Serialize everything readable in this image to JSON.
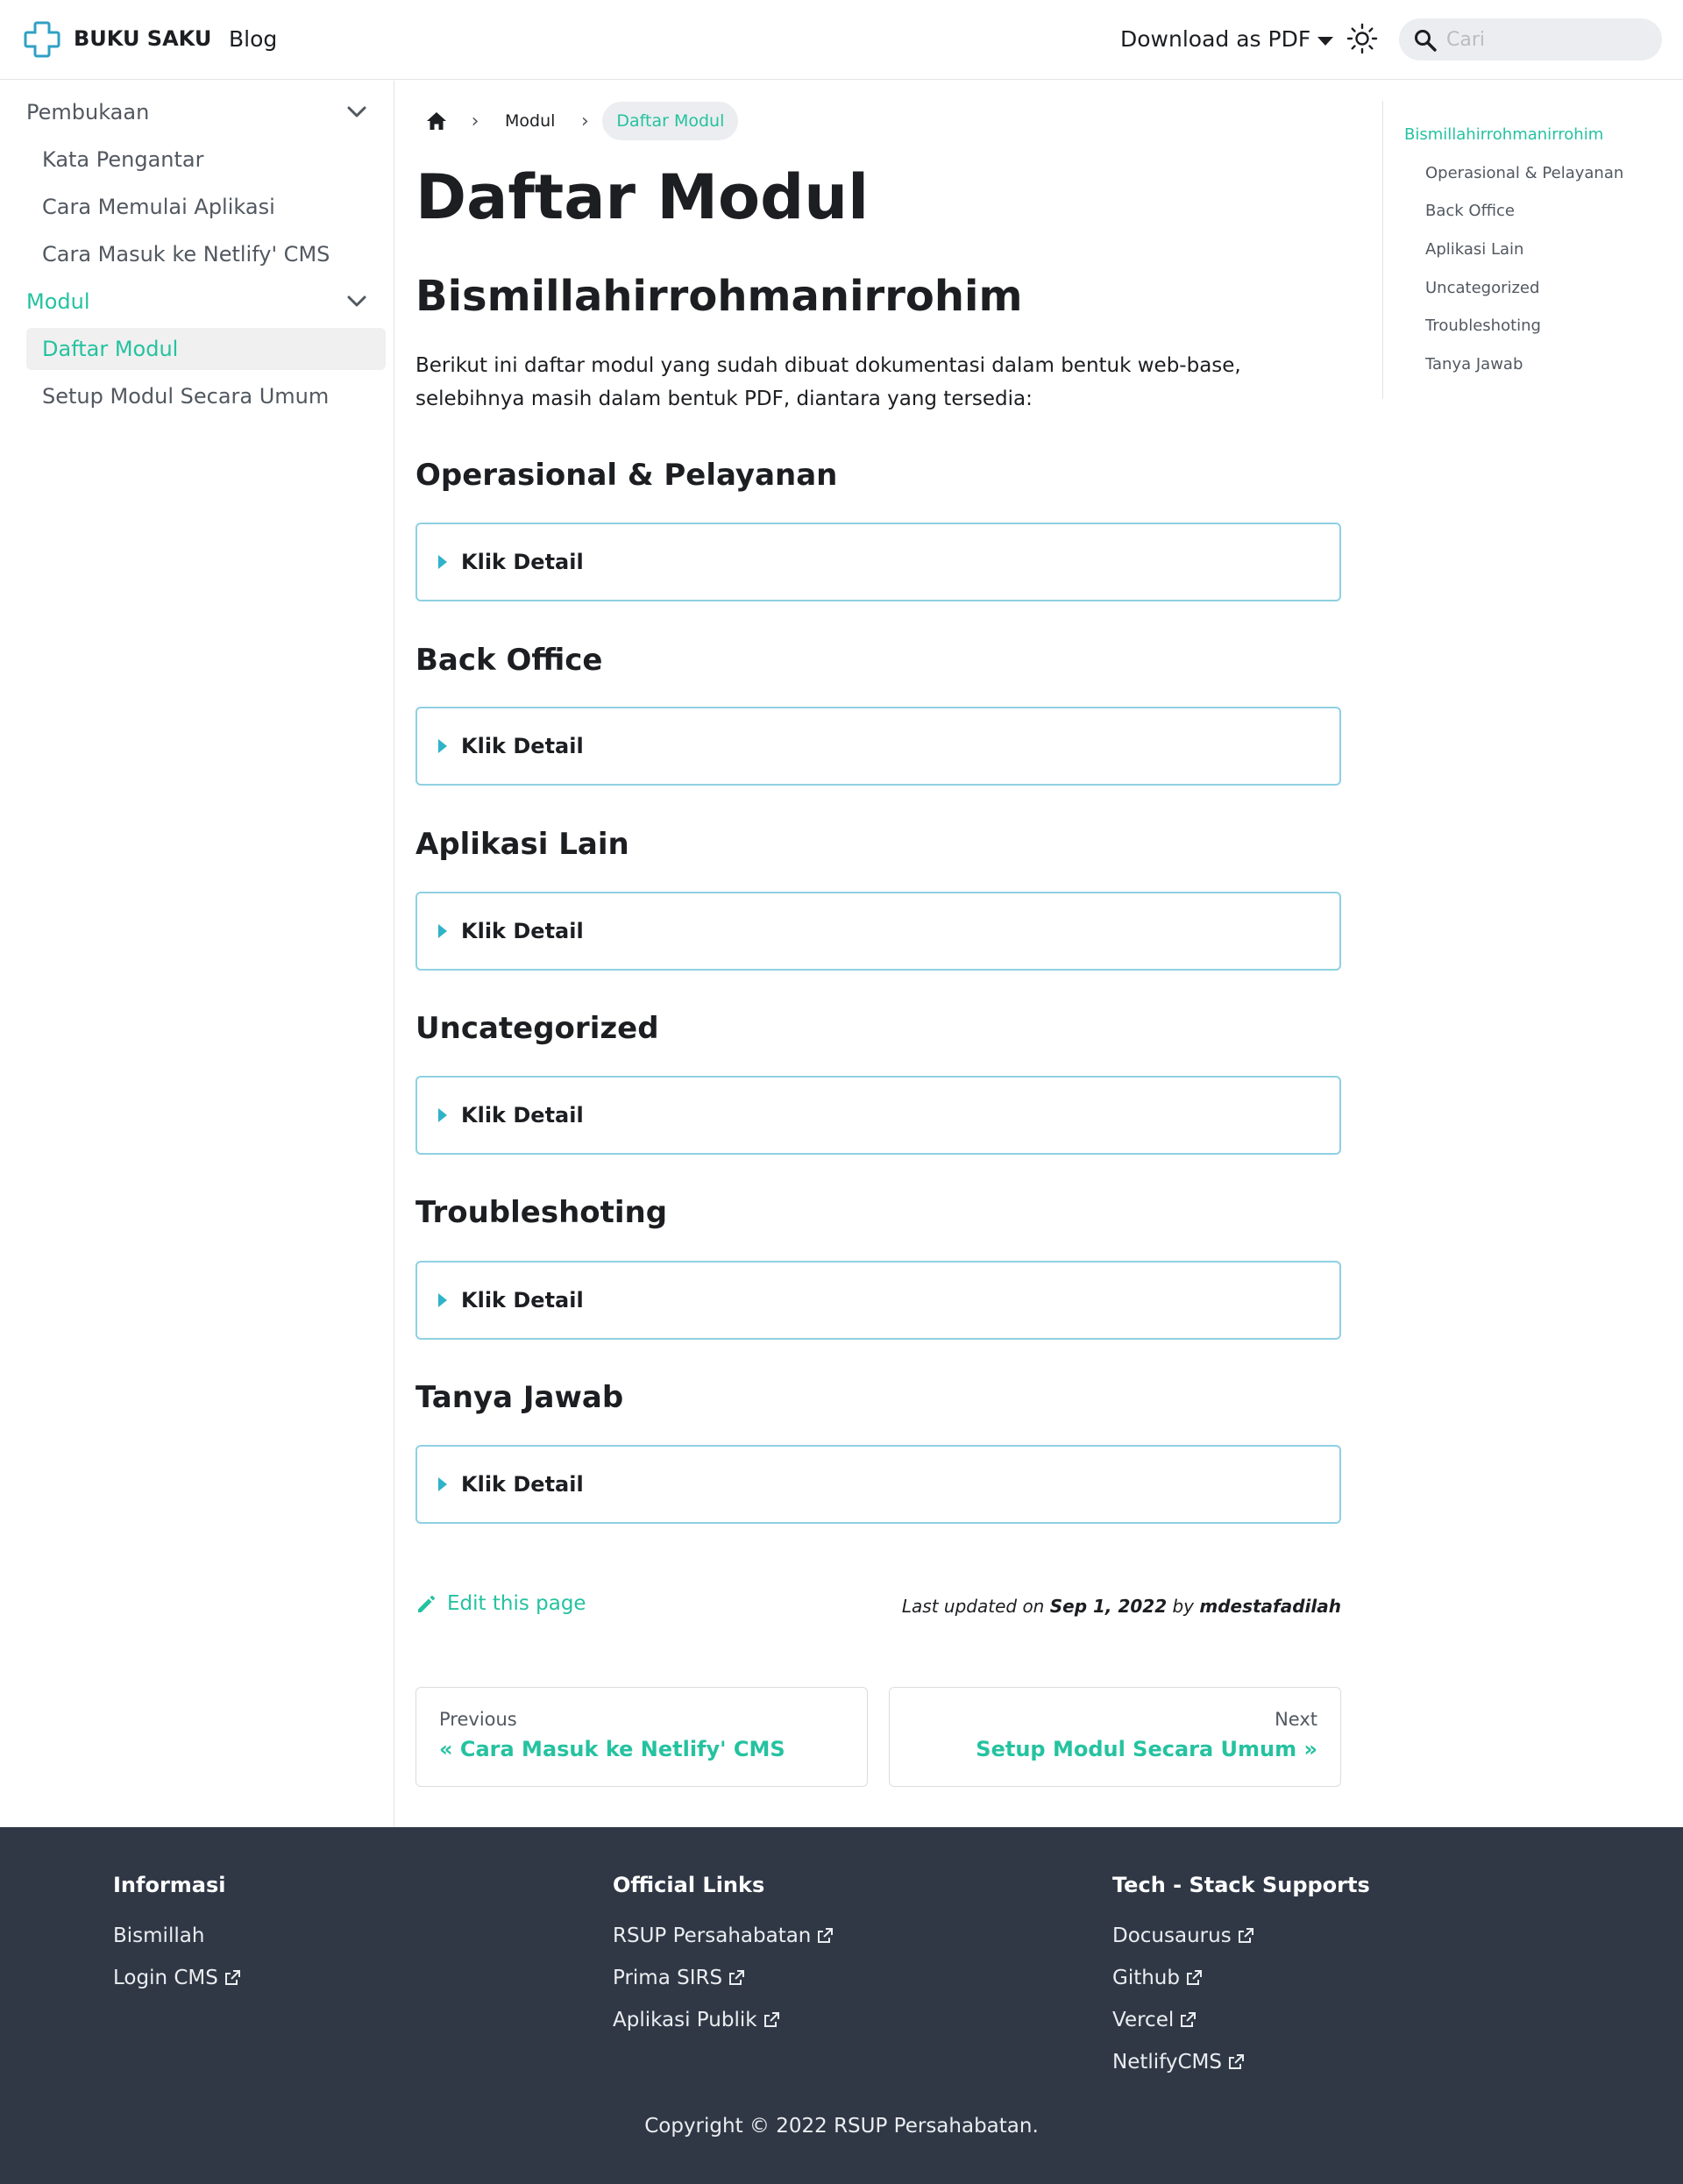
{
  "navbar": {
    "brand": "BUKU SAKU",
    "blog": "Blog",
    "download": "Download as PDF",
    "search_placeholder": "Cari"
  },
  "sidebar": {
    "category_1": "Pembukaan",
    "items_1": [
      "Kata Pengantar",
      "Cara Memulai Aplikasi",
      "Cara Masuk ke Netlify' CMS"
    ],
    "category_2": "Modul",
    "items_2": [
      "Daftar Modul",
      "Setup Modul Secara Umum"
    ]
  },
  "breadcrumb": {
    "modul": "Modul",
    "current": "Daftar Modul"
  },
  "main": {
    "title": "Daftar Modul",
    "subtitle": "Bismillahirrohmanirrohim",
    "intro": "Berikut ini daftar modul yang sudah dibuat dokumentasi dalam bentuk web-base, selebihnya masih dalam bentuk PDF, diantara yang tersedia:",
    "sections": [
      {
        "heading": "Operasional & Pelayanan",
        "details": "Klik Detail"
      },
      {
        "heading": "Back Office",
        "details": "Klik Detail"
      },
      {
        "heading": "Aplikasi Lain",
        "details": "Klik Detail"
      },
      {
        "heading": "Uncategorized",
        "details": "Klik Detail"
      },
      {
        "heading": "Troubleshoting",
        "details": "Klik Detail"
      },
      {
        "heading": "Tanya Jawab",
        "details": "Klik Detail"
      }
    ],
    "edit": "Edit this page",
    "updated_prefix": "Last updated on ",
    "updated_date": "Sep 1, 2022",
    "updated_by": " by ",
    "updated_author": "mdestafadilah"
  },
  "pager": {
    "prev_sub": "Previous",
    "prev_label": "« Cara Masuk ke Netlify' CMS",
    "next_sub": "Next",
    "next_label": "Setup Modul Secara Umum »"
  },
  "toc": [
    "Bismillahirrohmanirrohim",
    "Operasional & Pelayanan",
    "Back Office",
    "Aplikasi Lain",
    "Uncategorized",
    "Troubleshoting",
    "Tanya Jawab"
  ],
  "footer": {
    "col1_title": "Informasi",
    "col1_links": [
      "Bismillah",
      "Login CMS"
    ],
    "col2_title": "Official Links",
    "col2_links": [
      "RSUP Persahabatan",
      "Prima SIRS",
      "Aplikasi Publik"
    ],
    "col3_title": "Tech - Stack Supports",
    "col3_links": [
      "Docusaurus",
      "Github",
      "Vercel",
      "NetlifyCMS"
    ],
    "copyright": "Copyright © 2022 RSUP Persahabatan."
  },
  "colors": {
    "accent": "#25c2a0",
    "details_border": "#8fd0e2",
    "footer_bg": "#303846"
  }
}
